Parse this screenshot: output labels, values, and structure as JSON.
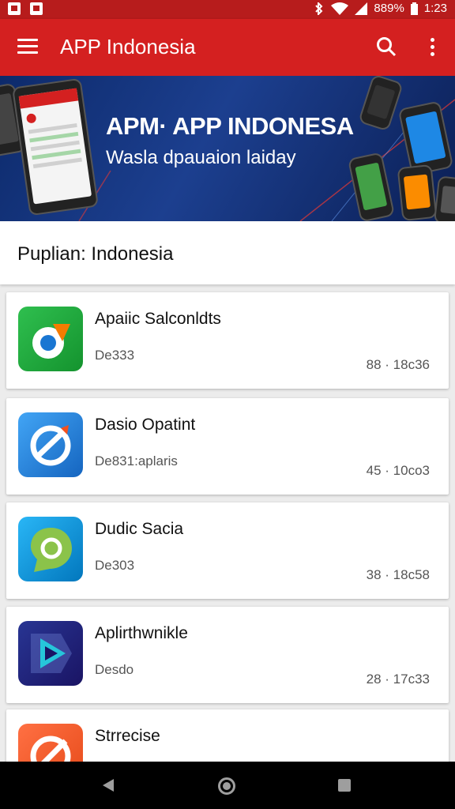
{
  "status_bar": {
    "battery": "889%",
    "time": "1:23",
    "icons": [
      "notification-icon",
      "notification-icon",
      "bluetooth-icon",
      "wifi-icon",
      "signal-icon",
      "battery-icon"
    ]
  },
  "app_bar": {
    "title": "APP Indonesia",
    "icons": [
      "menu-icon",
      "search-icon",
      "more-vert-icon"
    ]
  },
  "banner": {
    "title": "APM· APP INDONESA",
    "subtitle": "Wasla dpauaion laiday"
  },
  "section": {
    "title": "Puplian: Indonesia"
  },
  "apps": [
    {
      "name": "Apaiic Salconldts",
      "subtitle": "De333",
      "meta": "88 · 18c36",
      "icon": "app-icon-green",
      "colors": [
        "#1faa3c",
        "#3cc455"
      ]
    },
    {
      "name": "Dasio Opatint",
      "subtitle": "De831:aplaris",
      "meta": "45 · 10co3",
      "icon": "app-icon-blue",
      "colors": [
        "#1565c0",
        "#42a5f5"
      ]
    },
    {
      "name": "Dudic Sacia",
      "subtitle": "De303",
      "meta": "38 · 18c58",
      "icon": "app-icon-teal-green",
      "colors": [
        "#0288d1",
        "#43a047"
      ]
    },
    {
      "name": "Aplirthwnikle",
      "subtitle": "Desdo",
      "meta": "28 · 17c33",
      "icon": "app-icon-purple-play",
      "colors": [
        "#1a237e",
        "#311b92"
      ]
    },
    {
      "name": "Strrecise",
      "subtitle": "",
      "meta": "",
      "icon": "app-icon-orange",
      "colors": [
        "#e64a19",
        "#ff7043"
      ]
    }
  ],
  "nav_bar": {
    "icons": [
      "back-icon",
      "home-icon",
      "recents-icon"
    ]
  },
  "colors": {
    "primary": "#d42020",
    "status_bar": "#b71c1c",
    "banner": "#0d2a6b"
  }
}
